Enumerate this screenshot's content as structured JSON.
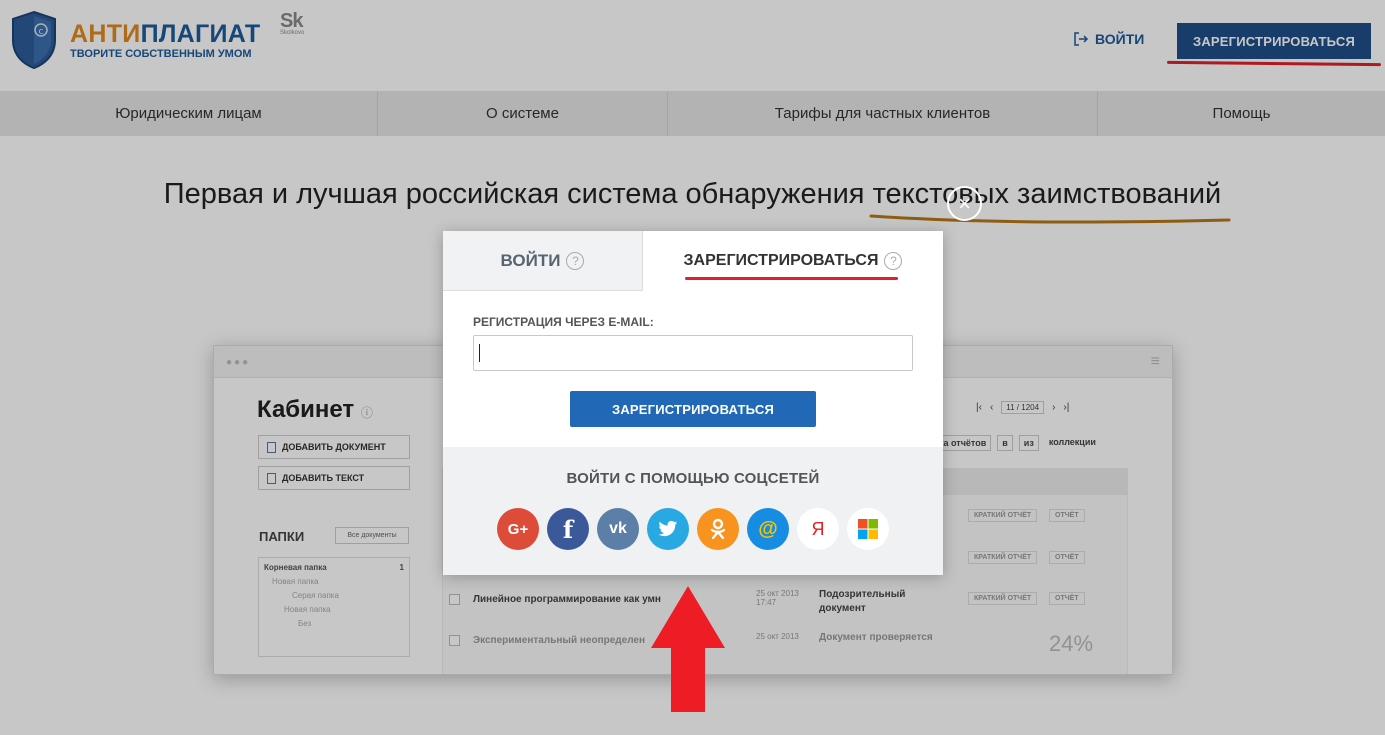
{
  "header": {
    "logo_part1": "АНТИ",
    "logo_part2": "ПЛАГИАТ",
    "logo_tagline": "ТВОРИТЕ СОБСТВЕННЫМ УМОМ",
    "partner_logo": "Sk",
    "partner_logo_sub": "Skolkovo",
    "login_label": "ВОЙТИ",
    "register_label": "ЗАРЕГИСТРИРОВАТЬСЯ"
  },
  "nav": {
    "items": [
      {
        "label": "Юридическим лицам"
      },
      {
        "label": "О системе"
      },
      {
        "label": "Тарифы для частных клиентов"
      },
      {
        "label": "Помощь"
      }
    ]
  },
  "hero": {
    "headline": "Первая и лучшая российская система обнаружения текстовых заимствований"
  },
  "background_cabinet": {
    "title": "Кабинет",
    "add_document": "ДОБАВИТЬ ДОКУМЕНТ",
    "add_text": "ДОБАВИТЬ ТЕКСТ",
    "folders_label": "ПАПКИ",
    "all_documents": "Все документы",
    "root_folder": "Корневая папка",
    "root_count": "1",
    "tree": [
      "Новая папка",
      "Серая папка",
      "Новая папка",
      "Без"
    ],
    "pager": "11 / 1204",
    "tools": [
      "ка отчётов",
      "в",
      "из",
      "коллекции"
    ],
    "rows": [
      {
        "doc": "Линейное программирование как умн",
        "date": "25 окт 2013 17:47",
        "status": "Подозрительный документ",
        "report": "КРАТКИЙ ОТЧЁТ",
        "report2": "ОТЧЁТ"
      },
      {
        "doc": "Экспериментальный неопределен",
        "date": "25 окт 2013",
        "status": "Документ проверяется",
        "percent": "24%"
      }
    ]
  },
  "modal": {
    "tab_login": "ВОЙТИ",
    "tab_register": "ЗАРЕГИСТРИРОВАТЬСЯ",
    "help_glyph": "?",
    "email_label": "РЕГИСТРАЦИЯ ЧЕРЕЗ E-MAIL:",
    "email_value": "",
    "submit_label": "ЗАРЕГИСТРИРОВАТЬСЯ",
    "social_title": "ВОЙТИ С ПОМОЩЬЮ СОЦСЕТЕЙ",
    "social": [
      {
        "icon": "google-plus-icon",
        "glyph": "G+",
        "color": "#dd4b39",
        "fg": "#ffffff"
      },
      {
        "icon": "facebook-icon",
        "glyph": "f",
        "color": "#3b5998",
        "fg": "#ffffff"
      },
      {
        "icon": "vk-icon",
        "glyph": "vk",
        "color": "#5b7fa6",
        "fg": "#ffffff"
      },
      {
        "icon": "twitter-icon",
        "glyph": "t",
        "color": "#29a9e1",
        "fg": "#ffffff"
      },
      {
        "icon": "odnoklassniki-icon",
        "glyph": "ok",
        "color": "#f7931e",
        "fg": "#ffffff"
      },
      {
        "icon": "mailru-icon",
        "glyph": "@",
        "color": "#168de2",
        "fg": "#f7c600"
      },
      {
        "icon": "yandex-icon",
        "glyph": "Я",
        "color": "#ffffff",
        "fg": "#e02020"
      },
      {
        "icon": "microsoft-icon",
        "glyph": "",
        "color": "#ffffff",
        "fg": "#ffffff"
      }
    ]
  },
  "colors": {
    "brand_blue": "#1f4f8a",
    "brand_orange": "#e08a1e",
    "accent_red": "#e0202a",
    "button_blue": "#2169b6"
  }
}
